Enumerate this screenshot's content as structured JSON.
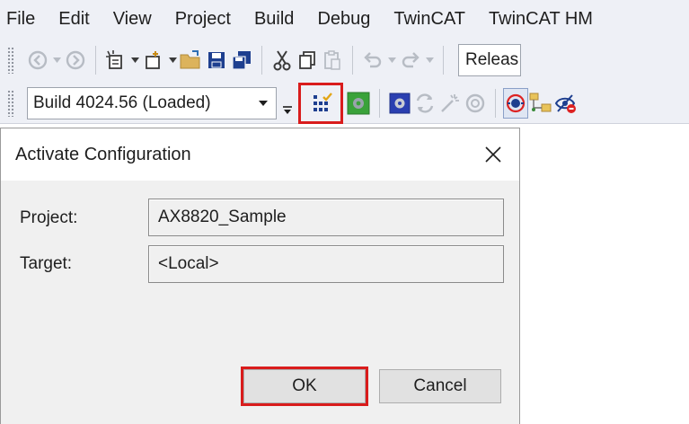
{
  "menu": [
    "File",
    "Edit",
    "View",
    "Project",
    "Build",
    "Debug",
    "TwinCAT",
    "TwinCAT HM"
  ],
  "toolbar1": {
    "icons": [
      "back-icon",
      "forward-icon",
      "new-project-icon",
      "add-item-icon",
      "open-folder-icon",
      "save-icon",
      "save-all-icon",
      "cut-icon",
      "copy-icon",
      "paste-icon",
      "undo-icon",
      "redo-icon"
    ],
    "configuration_value": "Releas"
  },
  "toolbar2": {
    "build_combo_value": "Build 4024.56 (Loaded)",
    "icons": [
      "activate-configuration-icon",
      "restart-twincat-icon",
      "target-system-icon",
      "reload-devices-icon",
      "scan-icon",
      "toggle-free-run-icon",
      "show-online-data-icon",
      "choose-target-icon",
      "disable-icon"
    ],
    "highlight_color": "#d91c1c"
  },
  "dialog": {
    "title": "Activate Configuration",
    "project_label": "Project:",
    "project_value": "AX8820_Sample",
    "target_label": "Target:",
    "target_value": "<Local>",
    "ok_label": "OK",
    "cancel_label": "Cancel"
  }
}
